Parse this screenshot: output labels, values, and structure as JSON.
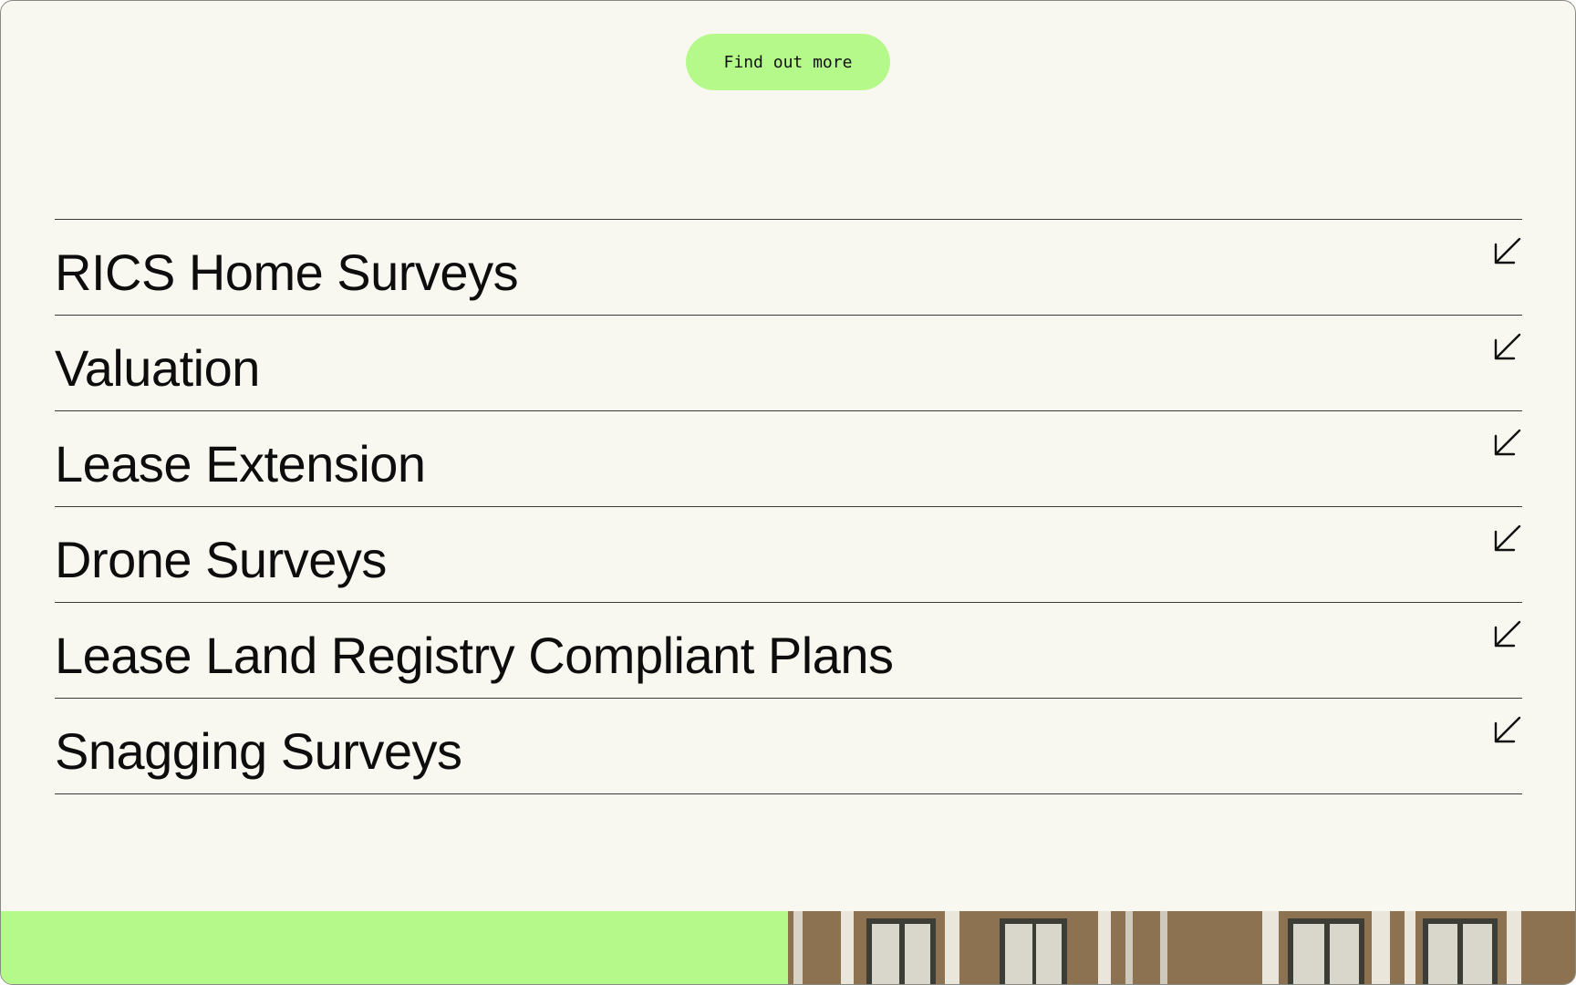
{
  "cta": {
    "label": "Find out more"
  },
  "services": [
    {
      "title": "RICS Home Surveys"
    },
    {
      "title": "Valuation"
    },
    {
      "title": "Lease Extension"
    },
    {
      "title": "Drone Surveys"
    },
    {
      "title": "Lease Land Registry Compliant Plans"
    },
    {
      "title": "Snagging Surveys"
    }
  ],
  "icons": {
    "row_arrow": "arrow-down-left-icon"
  },
  "colors": {
    "accent": "#b4f98a",
    "background": "#f8f8f1",
    "text": "#0d0d0d",
    "divider": "#3a3a3a"
  }
}
